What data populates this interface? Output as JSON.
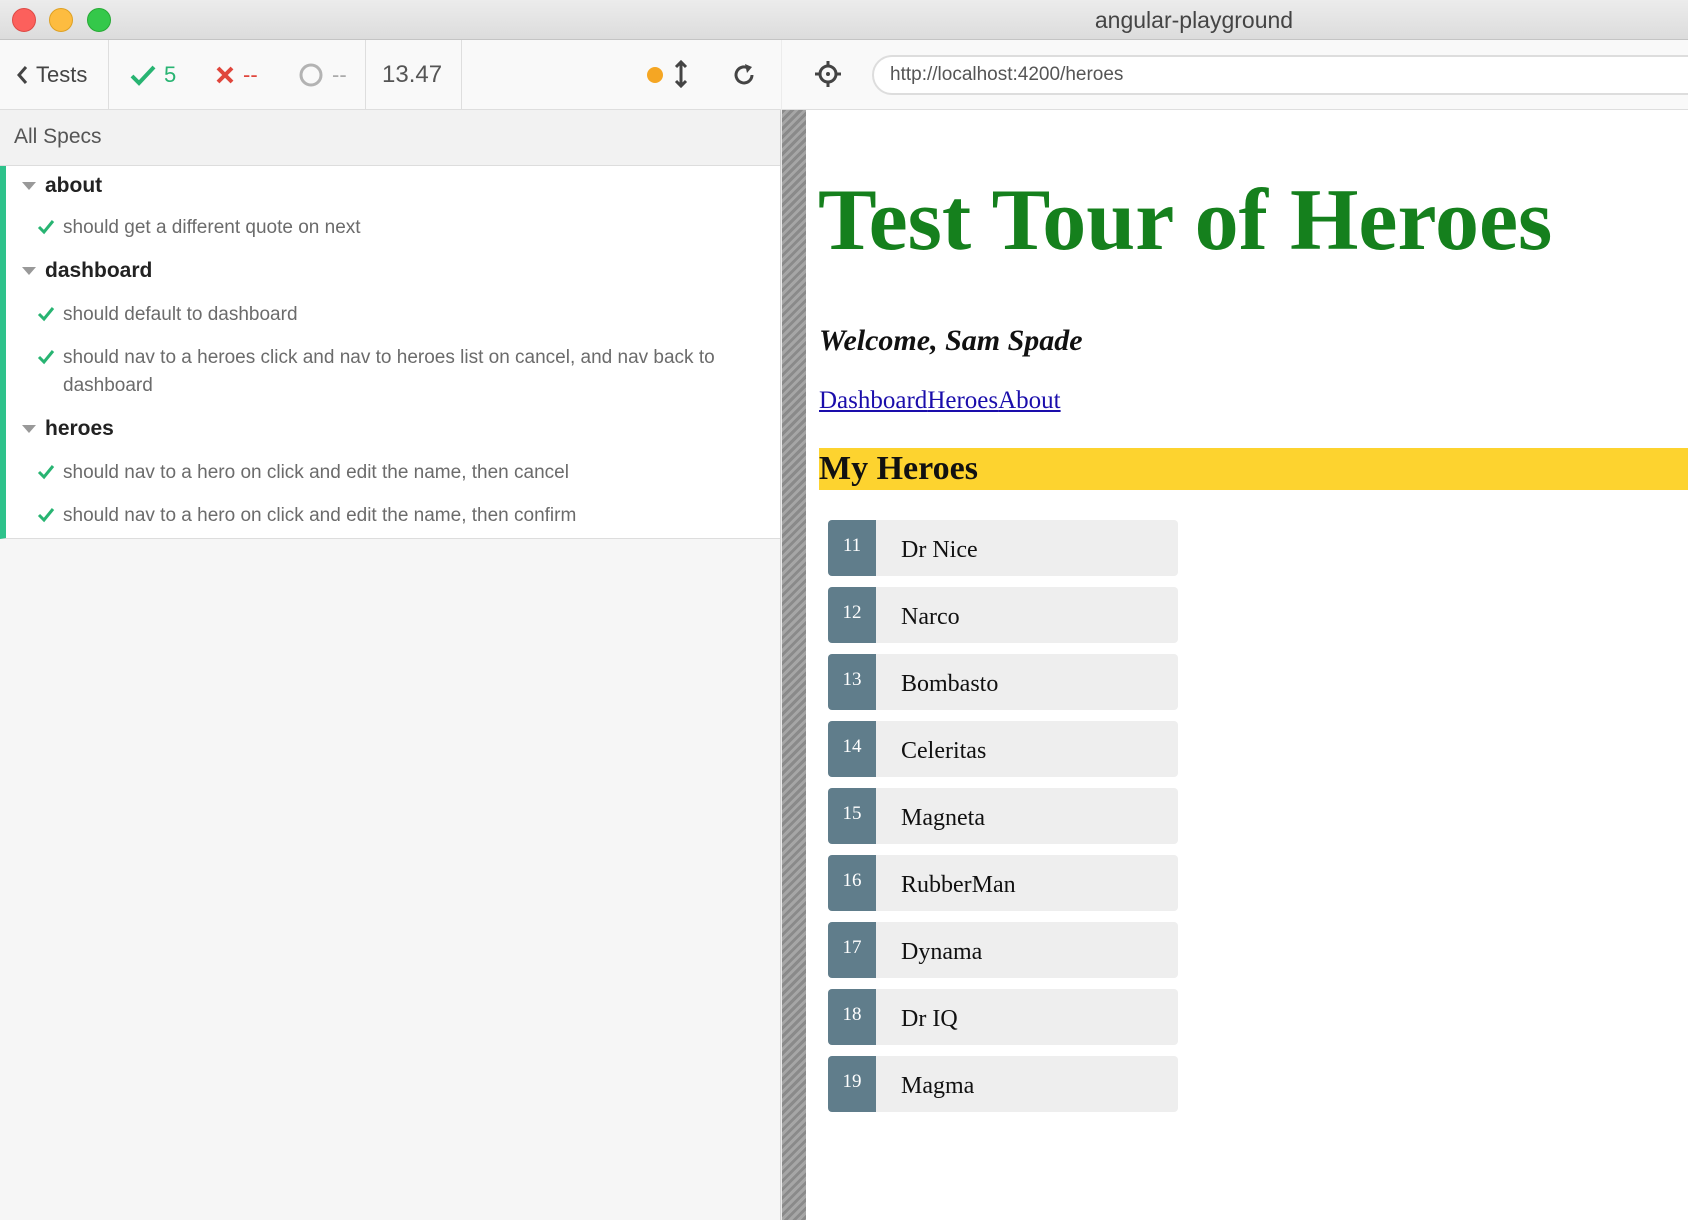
{
  "window": {
    "title": "angular-playground"
  },
  "reporter": {
    "back_label": "Tests",
    "passed_count": "5",
    "failed_count": "--",
    "pending_count": "--",
    "duration": "13.47",
    "all_specs_label": "All Specs",
    "suites": [
      {
        "name": "about",
        "tests": [
          "should get a different quote on next"
        ]
      },
      {
        "name": "dashboard",
        "tests": [
          "should default to dashboard",
          "should nav to a heroes click and nav to heroes list on cancel, and nav back to dashboard"
        ]
      },
      {
        "name": "heroes",
        "tests": [
          "should nav to a hero on click and edit the name, then cancel",
          "should nav to a hero on click and edit the name, then confirm"
        ]
      }
    ]
  },
  "browser": {
    "url": "http://localhost:4200/heroes"
  },
  "app": {
    "title": "Test Tour of Heroes",
    "welcome": "Welcome, Sam Spade",
    "nav": [
      "Dashboard",
      "Heroes",
      "About"
    ],
    "heading": "My Heroes",
    "heroes": [
      {
        "id": "11",
        "name": "Dr Nice"
      },
      {
        "id": "12",
        "name": "Narco"
      },
      {
        "id": "13",
        "name": "Bombasto"
      },
      {
        "id": "14",
        "name": "Celeritas"
      },
      {
        "id": "15",
        "name": "Magneta"
      },
      {
        "id": "16",
        "name": "RubberMan"
      },
      {
        "id": "17",
        "name": "Dynama"
      },
      {
        "id": "18",
        "name": "Dr IQ"
      },
      {
        "id": "19",
        "name": "Magma"
      }
    ]
  },
  "colors": {
    "pass": "#28b472",
    "fail": "#e0463c",
    "app_title": "#15801d",
    "heading_bg": "#fdd32f",
    "badge_bg": "#607d8b"
  }
}
